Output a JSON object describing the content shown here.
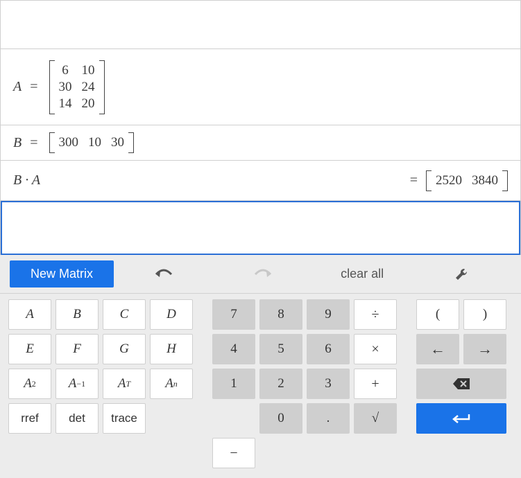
{
  "rows": {
    "A": {
      "name": "A",
      "eq": "=",
      "matrix": [
        [
          "6",
          "10"
        ],
        [
          "30",
          "24"
        ],
        [
          "14",
          "20"
        ]
      ]
    },
    "B": {
      "name": "B",
      "eq": "=",
      "matrix": [
        [
          "300",
          "10",
          "30"
        ]
      ]
    },
    "expr": {
      "lhs": "B · A",
      "eq": "=",
      "result": [
        [
          "2520",
          "3840"
        ]
      ]
    }
  },
  "toolbar": {
    "new_matrix": "New Matrix",
    "clear_all": "clear all"
  },
  "keypad": {
    "vars": {
      "A": "A",
      "B": "B",
      "C": "C",
      "D": "D",
      "E": "E",
      "F": "F",
      "G": "G",
      "H": "H",
      "Asq_base": "A",
      "Asq_exp": "2",
      "Ainv_base": "A",
      "Ainv_exp": "−1",
      "AT_base": "A",
      "AT_exp": "T",
      "An_base": "A",
      "An_exp": "n",
      "rref": "rref",
      "det": "det",
      "trace": "trace"
    },
    "nums": {
      "7": "7",
      "8": "8",
      "9": "9",
      "div": "÷",
      "4": "4",
      "5": "5",
      "6": "6",
      "mul": "×",
      "1": "1",
      "2": "2",
      "3": "3",
      "plus": "+",
      "0": "0",
      "dot": ".",
      "sqrt": "√",
      "minus": "−"
    },
    "navs": {
      "lparen": "(",
      "rparen": ")",
      "left": "←",
      "right": "→",
      "bksp": "⌫",
      "enter": "↵"
    }
  }
}
